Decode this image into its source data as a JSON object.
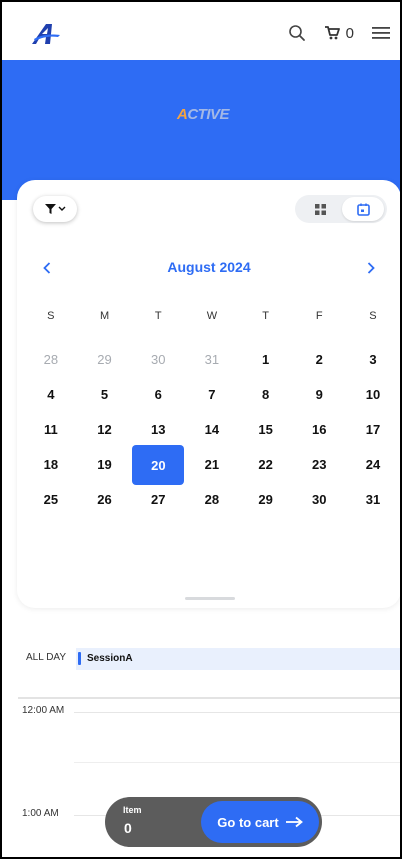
{
  "header": {
    "logo_icon": "active-a-logo-icon",
    "search_icon": "search-icon",
    "cart_icon": "cart-icon",
    "cart_count": "0",
    "menu_icon": "hamburger-menu-icon"
  },
  "hero": {
    "brand_logo": "ACTIVE",
    "brand_color": "#2e6cf4"
  },
  "toolbar": {
    "filter_icon": "filter-icon",
    "view_grid_icon": "grid-view-icon",
    "view_calendar_icon": "calendar-view-icon",
    "selected_view": "calendar"
  },
  "calendar": {
    "month_label": "August 2024",
    "weekdays": [
      "S",
      "M",
      "T",
      "W",
      "T",
      "F",
      "S"
    ],
    "weeks": [
      [
        {
          "d": "28",
          "muted": true
        },
        {
          "d": "29",
          "muted": true
        },
        {
          "d": "30",
          "muted": true
        },
        {
          "d": "31",
          "muted": true
        },
        {
          "d": "1"
        },
        {
          "d": "2"
        },
        {
          "d": "3"
        }
      ],
      [
        {
          "d": "4"
        },
        {
          "d": "5"
        },
        {
          "d": "6"
        },
        {
          "d": "7"
        },
        {
          "d": "8"
        },
        {
          "d": "9"
        },
        {
          "d": "10"
        }
      ],
      [
        {
          "d": "11"
        },
        {
          "d": "12"
        },
        {
          "d": "13"
        },
        {
          "d": "14"
        },
        {
          "d": "15"
        },
        {
          "d": "16"
        },
        {
          "d": "17"
        }
      ],
      [
        {
          "d": "18"
        },
        {
          "d": "19"
        },
        {
          "d": "20",
          "selected": true
        },
        {
          "d": "21"
        },
        {
          "d": "22"
        },
        {
          "d": "23"
        },
        {
          "d": "24"
        }
      ],
      [
        {
          "d": "25"
        },
        {
          "d": "26"
        },
        {
          "d": "27"
        },
        {
          "d": "28"
        },
        {
          "d": "29"
        },
        {
          "d": "30"
        },
        {
          "d": "31"
        }
      ]
    ]
  },
  "schedule": {
    "all_day_label": "ALL DAY",
    "all_day_event": "SessionA",
    "times": [
      "12:00 AM",
      "1:00 AM"
    ]
  },
  "cart_bar": {
    "items_label": "Item",
    "items_count": "0",
    "go_button": "Go to cart",
    "go_icon": "arrow-right-icon"
  }
}
